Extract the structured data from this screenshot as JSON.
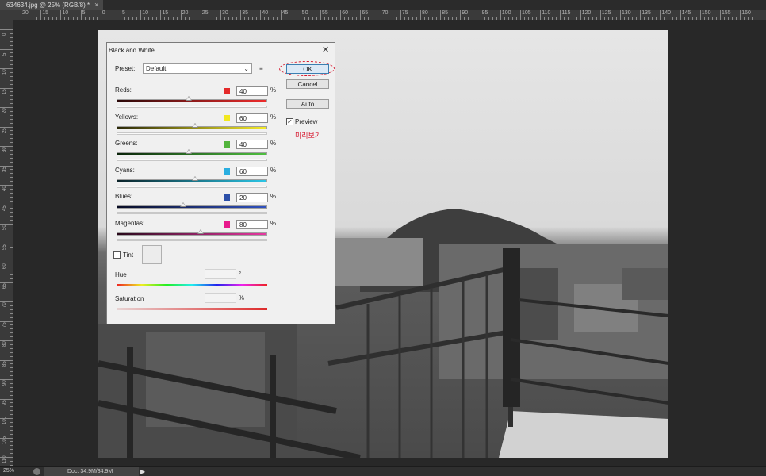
{
  "document": {
    "tab_title": "634634.jpg @ 25% (RGB/8) *",
    "tab_close": "×"
  },
  "ruler": {
    "h_labels": [
      "20",
      "15",
      "10",
      "5",
      "0",
      "5",
      "10",
      "15",
      "20",
      "25",
      "30",
      "35",
      "40",
      "45",
      "50",
      "55",
      "60",
      "65",
      "70",
      "75",
      "80",
      "85",
      "90",
      "95",
      "100",
      "105",
      "110",
      "115",
      "120",
      "125",
      "130",
      "135",
      "140",
      "145",
      "150",
      "155",
      "160"
    ],
    "v_labels": [
      "0",
      "5",
      "10",
      "15",
      "20",
      "25",
      "30",
      "35",
      "40",
      "45",
      "50",
      "55",
      "60",
      "65",
      "70",
      "75",
      "80",
      "85",
      "90",
      "95",
      "100",
      "105",
      "110",
      "115"
    ]
  },
  "status": {
    "zoom": "25%",
    "doc": "Doc: 34.9M/34.9M",
    "arrow": "▶"
  },
  "dialog": {
    "title": "Black and White",
    "close": "✕",
    "preset_label": "Preset:",
    "preset_value": "Default",
    "preset_chevron": "⌄",
    "preset_menu_icon": "≡",
    "channels": [
      {
        "name": "Reds:",
        "value": "40",
        "pct": "%",
        "color": "#e42a2a",
        "grad": "linear-gradient(to right,#2a0808,#ee2c2c)",
        "pos": 0.48
      },
      {
        "name": "Yellows:",
        "value": "60",
        "pct": "%",
        "color": "#f2e820",
        "grad": "linear-gradient(to right,#2a2808,#f5eb2a)",
        "pos": 0.52
      },
      {
        "name": "Greens:",
        "value": "40",
        "pct": "%",
        "color": "#52b43c",
        "grad": "linear-gradient(to right,#0a240a,#4fc040)",
        "pos": 0.48
      },
      {
        "name": "Cyans:",
        "value": "60",
        "pct": "%",
        "color": "#2aaee0",
        "grad": "linear-gradient(to right,#0a2228,#2cc6e6)",
        "pos": 0.52
      },
      {
        "name": "Blues:",
        "value": "20",
        "pct": "%",
        "color": "#2c4fa8",
        "grad": "linear-gradient(to right,#080c24,#3052c0)",
        "pos": 0.44
      },
      {
        "name": "Magentas:",
        "value": "80",
        "pct": "%",
        "color": "#e81a8c",
        "grad": "linear-gradient(to right,#28081a,#e838a2)",
        "pos": 0.56
      }
    ],
    "buttons": {
      "ok": "OK",
      "cancel": "Cancel",
      "auto": "Auto"
    },
    "preview": {
      "label": "Preview",
      "checked": "✓",
      "annotation": "미리보기"
    },
    "tint": {
      "label": "Tint"
    },
    "hue": {
      "label": "Hue",
      "unit": "°"
    },
    "saturation": {
      "label": "Saturation",
      "unit": "%"
    }
  }
}
